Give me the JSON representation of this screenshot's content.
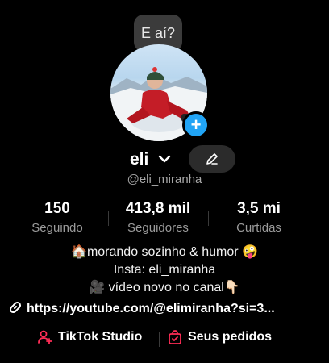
{
  "tooltip": {
    "text": "E aí?"
  },
  "profile": {
    "name": "eli",
    "handle": "@eli_miranha"
  },
  "stats": [
    {
      "value": "150",
      "label": "Seguindo"
    },
    {
      "value": "413,8 mil",
      "label": "Seguidores"
    },
    {
      "value": "3,5 mi",
      "label": "Curtidas"
    }
  ],
  "bio": {
    "line1": "🏠morando sozinho & humor 🤪",
    "line2": "Insta: eli_miranha",
    "line3": "🎥 vídeo novo no canal👇🏻"
  },
  "link": {
    "url": "https://youtube.com/@elimiranha?si=3..."
  },
  "actions": {
    "studio_label": "TikTok Studio",
    "orders_label": "Seus pedidos"
  },
  "colors": {
    "accent_plus": "#21a4f5",
    "action_icon": "#fe2c55",
    "background": "#000000"
  }
}
